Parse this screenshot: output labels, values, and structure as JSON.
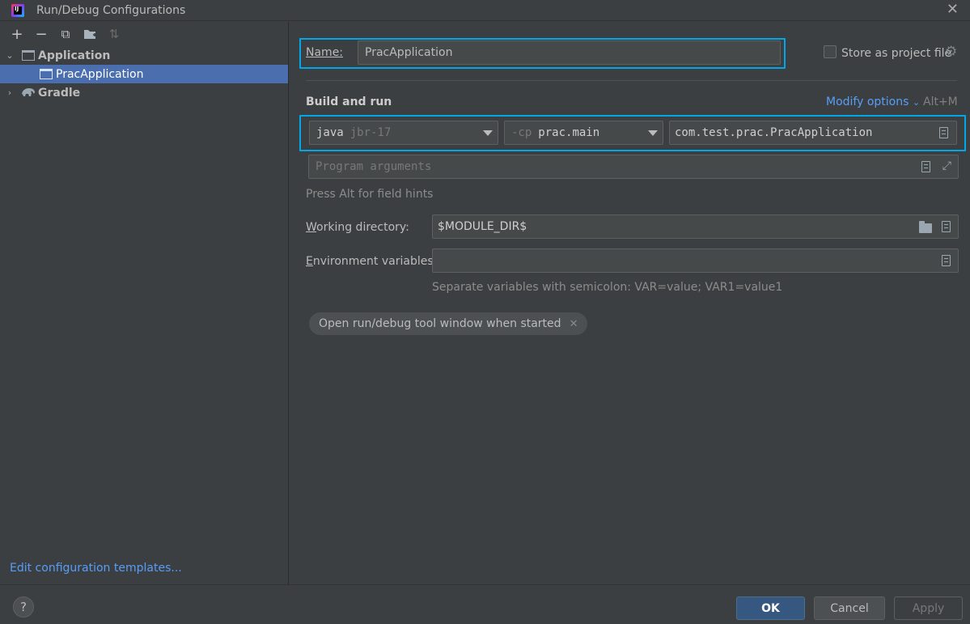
{
  "window": {
    "title": "Run/Debug Configurations"
  },
  "sidebar": {
    "toolbar": [
      {
        "icon": "plus-icon",
        "glyph": "+"
      },
      {
        "icon": "minus-icon",
        "glyph": "−"
      },
      {
        "icon": "copy-icon",
        "glyph": "⧉"
      },
      {
        "icon": "folder-add-icon",
        "glyph": "▆"
      },
      {
        "icon": "sort-icon",
        "glyph": "⇅"
      }
    ],
    "tree": {
      "application_label": "Application",
      "config_label": "PracApplication",
      "gradle_label": "Gradle"
    },
    "edit_templates_link": "Edit configuration templates..."
  },
  "form": {
    "name_label": "Name:",
    "name_value": "PracApplication",
    "store_as_project_label": "Store as project file",
    "section_title": "Build and run",
    "modify_options_label": "Modify options",
    "modify_options_shortcut": "Alt+M",
    "jdk_keyword": "java",
    "jdk_value": "jbr-17",
    "cp_keyword": "-cp",
    "cp_value": "prac.main",
    "main_class_value": "com.test.prac.PracApplication",
    "program_args_placeholder": "Program arguments",
    "field_hints_text": "Press Alt for field hints",
    "working_dir_label": "Working directory:",
    "working_dir_value": "$MODULE_DIR$",
    "env_vars_label": "Environment variables:",
    "env_vars_value": "",
    "env_vars_hint": "Separate variables with semicolon: VAR=value; VAR1=value1",
    "open_tool_window_chip": "Open run/debug tool window when started"
  },
  "footer": {
    "help_label": "?",
    "ok_label": "OK",
    "cancel_label": "Cancel",
    "apply_label": "Apply"
  },
  "colors": {
    "background": "#3c3f41",
    "selection": "#4b6eaf",
    "highlight_box": "#00a8e8",
    "link": "#589df6",
    "primary_button": "#365880"
  }
}
